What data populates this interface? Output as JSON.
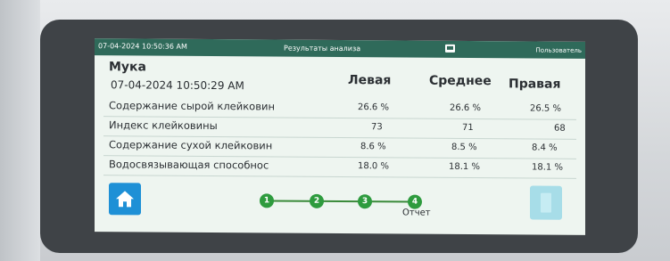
{
  "statusbar": {
    "datetime": "07-04-2024 10:50:36 AM",
    "title": "Результаты анализа",
    "user": "Пользователь"
  },
  "sample": {
    "name": "Мука",
    "datetime": "07-04-2024 10:50:29 AM"
  },
  "columns": [
    "Левая",
    "Среднее",
    "Правая"
  ],
  "rows": [
    {
      "label": "Содержание сырой клейковин",
      "values": [
        "26.6  %",
        "26.6  %",
        "26.5  %"
      ]
    },
    {
      "label": "Индекс клейковины",
      "values": [
        "73",
        "71",
        "68"
      ]
    },
    {
      "label": "Содержание сухой клейковин",
      "values": [
        "8.6  %",
        "8.5  %",
        "8.4  %"
      ]
    },
    {
      "label": "Водосвязывающая способнос",
      "values": [
        "18.0  %",
        "18.1  %",
        "18.1  %"
      ]
    }
  ],
  "steps": [
    "1",
    "2",
    "3",
    "4"
  ],
  "step_label": "Отчет",
  "colors": {
    "statusbar": "#2f6a5a",
    "screen_bg": "#eef5f0",
    "home_button": "#1e90d6",
    "step_dot": "#2e9b3e",
    "disabled_button": "#a7dde8"
  },
  "icons": {
    "home": "home-icon",
    "status": "screen-icon",
    "right_button": "document-icon"
  }
}
